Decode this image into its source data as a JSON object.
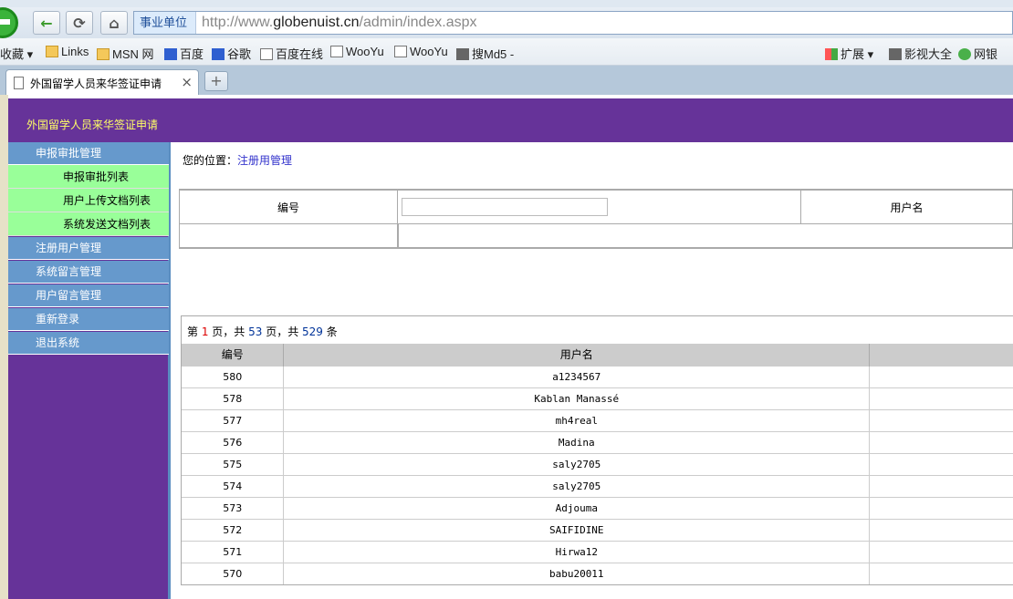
{
  "browser": {
    "zone_label": "事业单位",
    "url_prefix": "http://www.",
    "url_domain": "globenuist.cn",
    "url_path": "/admin/index.aspx",
    "favorites": [
      "收藏",
      "Links",
      "MSN 网",
      "百度",
      "谷歌",
      "百度在线",
      "WooYu",
      "WooYu",
      "搜Md5 -",
      "扩展",
      "影视大全",
      "网银"
    ],
    "tab_title": "外国留学人员来华签证申请",
    "tab_close": "×",
    "new_tab": "+"
  },
  "header": {
    "title": "外国留学人员来华签证申请"
  },
  "sidebar": {
    "group1": "申报审批管理",
    "sub": [
      "申报审批列表",
      "用户上传文档列表",
      "系统发送文档列表"
    ],
    "items": [
      "注册用户管理",
      "系统留言管理",
      "用户留言管理",
      "重新登录",
      "退出系统"
    ]
  },
  "breadcrumb": {
    "label": "您的位置：",
    "current": "注册用管理"
  },
  "filter": {
    "id_label": "编号",
    "user_label": "用户名"
  },
  "pager": {
    "prefix": "第 ",
    "page": "1",
    "mid1": " 页，共 ",
    "pages": "53",
    "mid2": " 页，共 ",
    "total": "529",
    "suffix": " 条"
  },
  "table": {
    "headers": [
      "编号",
      "用户名",
      ""
    ],
    "rows": [
      [
        "580",
        "a1234567"
      ],
      [
        "578",
        "Kablan Manassé"
      ],
      [
        "577",
        "mh4real"
      ],
      [
        "576",
        "Madina"
      ],
      [
        "575",
        "saly2705"
      ],
      [
        "574",
        "saly2705"
      ],
      [
        "573",
        "Adjouma"
      ],
      [
        "572",
        "SAIFIDINE"
      ],
      [
        "571",
        "Hirwa12"
      ],
      [
        "570",
        "babu20011"
      ]
    ]
  }
}
